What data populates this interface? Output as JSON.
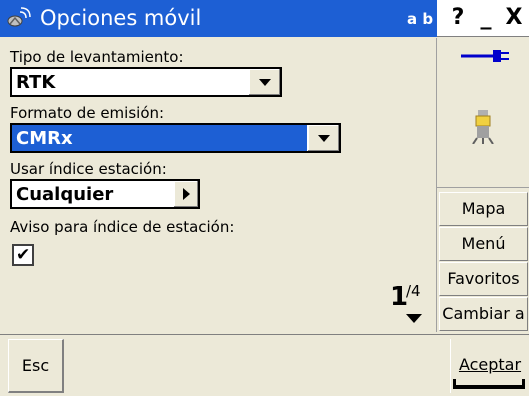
{
  "window": {
    "title": "Opciones móvil",
    "input_mode": "a b",
    "help_label": "?",
    "minimize_label": "_",
    "close_label": "X"
  },
  "form": {
    "survey_type": {
      "label": "Tipo de levantamiento:",
      "value": "RTK"
    },
    "broadcast_format": {
      "label": "Formato de emisión:",
      "value": "CMRx"
    },
    "station_index": {
      "label": "Usar índice estación:",
      "value": "Cualquier"
    },
    "station_index_warning": {
      "label": "Aviso para índice de estación:",
      "checked": true,
      "mark": "✔"
    }
  },
  "pager": {
    "current": "1",
    "total": "/4"
  },
  "side_buttons": [
    {
      "label": "Mapa"
    },
    {
      "label": "Menú"
    },
    {
      "label": "Favoritos"
    },
    {
      "label": "Cambiar a"
    }
  ],
  "bottom": {
    "esc_label": "Esc",
    "accept_label": "Aceptar"
  },
  "colors": {
    "accent": "#1d5fd4",
    "background": "#ece9d8"
  }
}
